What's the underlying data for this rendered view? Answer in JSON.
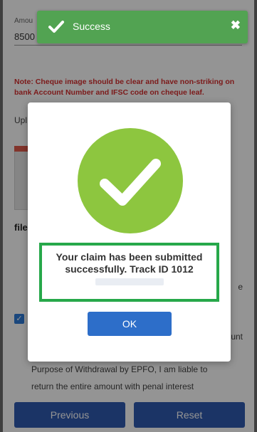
{
  "toast": {
    "message": "Success",
    "close_symbol": "✖"
  },
  "form": {
    "amount_label": "Amou",
    "amount_value": "8500",
    "note": "Note: Cheque image should be clear and have non-striking on bank Account Number and IFSC code on cheque leaf.",
    "upload_label": "Upl",
    "file_label": "file",
    "side_texts": [
      "e",
      "unt"
    ],
    "bottom_lines": [
      "Purpose of Withdrawal by EPFO, I am liable to",
      "return the entire amount with penal interest"
    ]
  },
  "modal": {
    "message_prefix": "Your claim has been submitted successfully. Track ID 1012",
    "ok_label": "OK"
  },
  "footer": {
    "previous_label": "Previous",
    "reset_label": "Reset"
  },
  "colors": {
    "toast_bg": "#52a352",
    "success_green": "#8dc63f",
    "highlight_box": "#27a84a",
    "primary_button": "#2d6ec9",
    "note_red": "#d63030"
  },
  "icons": {
    "toast": "check-icon",
    "close": "close-icon",
    "modal": "success-check-icon"
  }
}
